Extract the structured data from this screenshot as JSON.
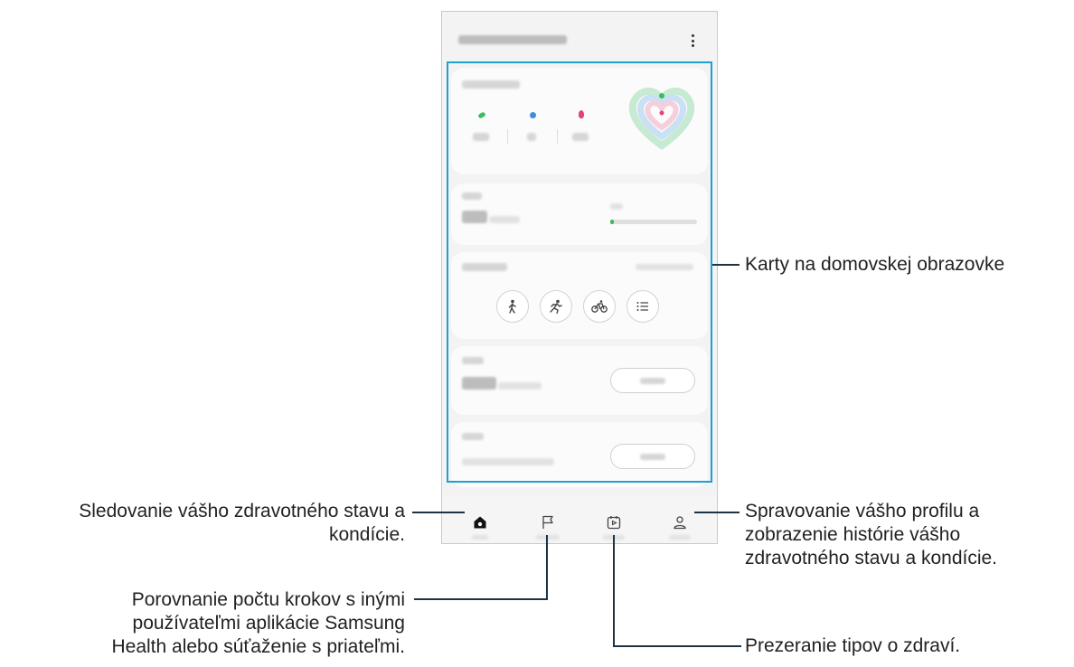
{
  "callouts": {
    "home_cards": "Karty na domovskej obrazovke",
    "tracking_line1": "Sledovanie vášho zdravotného stavu a",
    "tracking_line2": "kondície.",
    "steps_line1": "Porovnanie počtu krokov s inými",
    "steps_line2": "používateľmi aplikácie Samsung",
    "steps_line3": "Health alebo súťaženie s priateľmi.",
    "profile_line1": "Spravovanie vášho profilu a",
    "profile_line2": "zobrazenie histórie vášho",
    "profile_line3": "zdravotného stavu a kondície.",
    "tips": "Prezeranie tipov o zdraví."
  },
  "icons": {
    "menu": "more-vert-icon",
    "steps": "shoe-icon",
    "active_time": "clock-icon",
    "calories": "flame-icon",
    "walk": "walk-icon",
    "run": "run-icon",
    "cycle": "bike-icon",
    "list": "list-icon",
    "nav_home": "home-icon",
    "nav_together": "flag-icon",
    "nav_discover": "play-calendar-icon",
    "nav_profile": "person-icon"
  },
  "colors": {
    "highlight": "#1ea0d5",
    "leader_line": "#1d3344",
    "steps_green": "#3dbb5a",
    "active_blue": "#3d8ee0",
    "calories_pink": "#e5407a"
  }
}
